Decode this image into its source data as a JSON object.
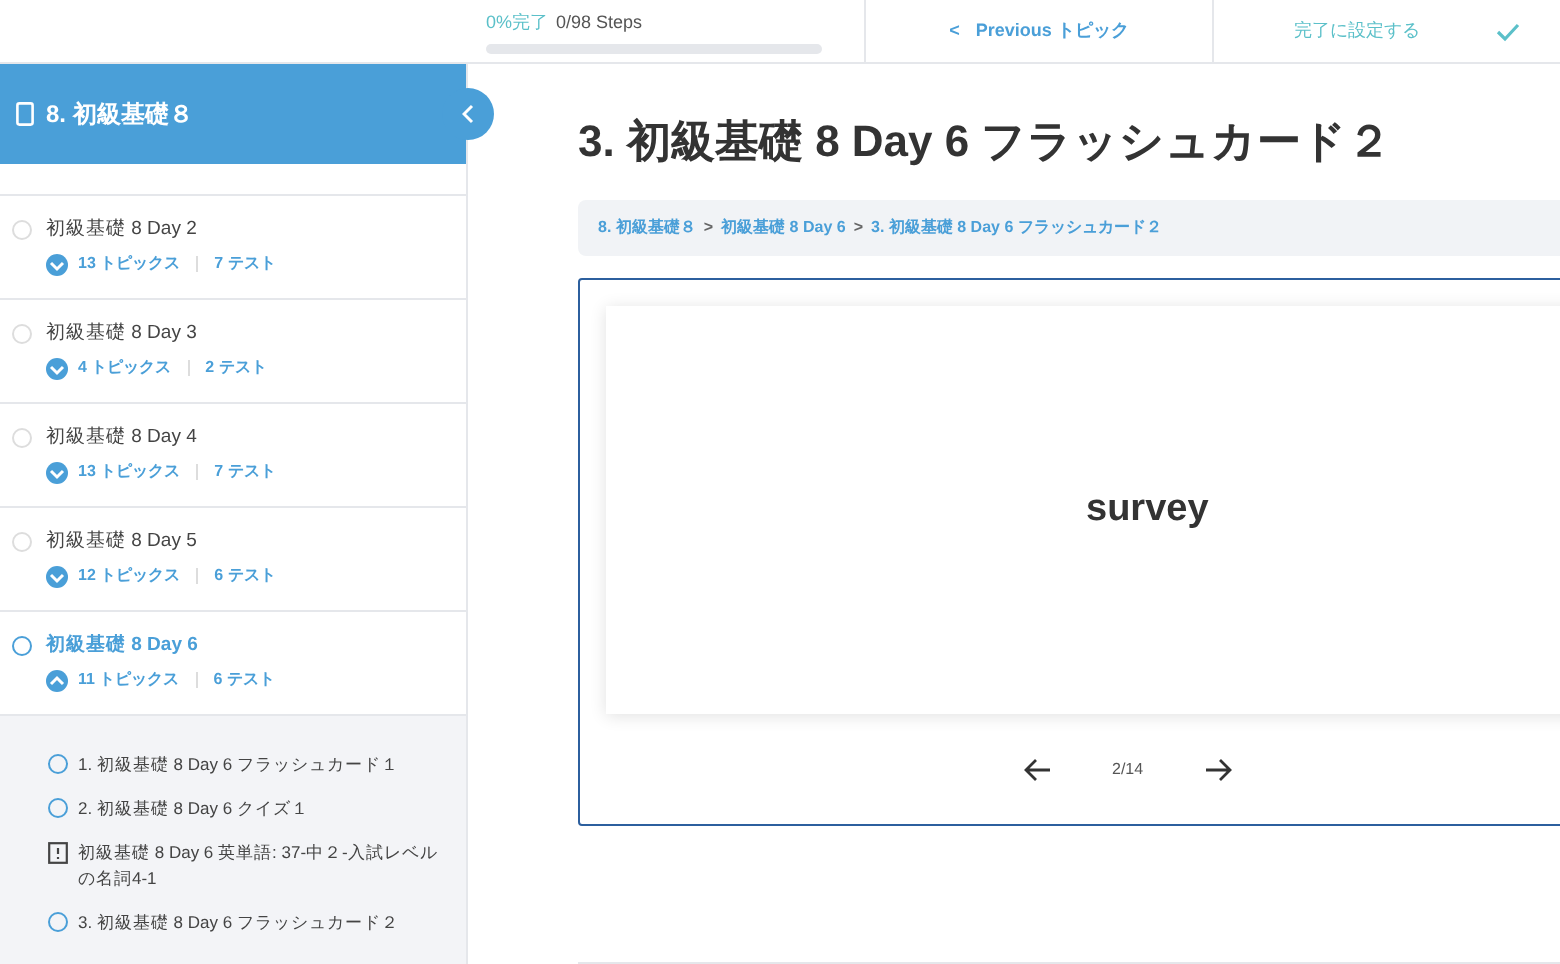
{
  "progress": {
    "percent": "0%完了",
    "steps": "0/98 Steps",
    "level": 0
  },
  "previous_button": {
    "arrow": "<",
    "label": "Previous トピック"
  },
  "complete_button": {
    "label": "完了に設定する"
  },
  "sidebar": {
    "title": "8. 初級基礎８",
    "sections": [
      {
        "title": "初級基礎 8 Day 2",
        "topics": "13 トピックス",
        "tests": "7 テスト",
        "selected": false,
        "expanded": false
      },
      {
        "title": "初級基礎 8 Day 3",
        "topics": "4 トピックス",
        "tests": "2 テスト",
        "selected": false,
        "expanded": false
      },
      {
        "title": "初級基礎 8 Day 4",
        "topics": "13 トピックス",
        "tests": "7 テスト",
        "selected": false,
        "expanded": false
      },
      {
        "title": "初級基礎 8 Day 5",
        "topics": "12 トピックス",
        "tests": "6 テスト",
        "selected": false,
        "expanded": false
      },
      {
        "title": "初級基礎 8 Day 6",
        "topics": "11 トピックス",
        "tests": "6 テスト",
        "selected": true,
        "expanded": true,
        "lessons": [
          {
            "kind": "topic",
            "title": "1. 初級基礎 8 Day 6 フラッシュカード１"
          },
          {
            "kind": "topic",
            "title": "2. 初級基礎 8 Day 6 クイズ１"
          },
          {
            "kind": "quiz",
            "title": "初級基礎 8 Day 6 英単語: 37-中２-入試レベルの名詞4-1"
          },
          {
            "kind": "topic",
            "title": "3. 初級基礎 8 Day 6 フラッシュカード２"
          }
        ]
      }
    ]
  },
  "main": {
    "title": "3. 初級基礎 8 Day 6 フラッシュカード２",
    "breadcrumbs": [
      "8. 初級基礎８",
      "初級基礎 8 Day 6",
      "3. 初級基礎 8 Day 6 フラッシュカード２"
    ],
    "breadcrumb_separator": ">",
    "flashcard": {
      "word": "survey",
      "counter": "2/14"
    }
  }
}
